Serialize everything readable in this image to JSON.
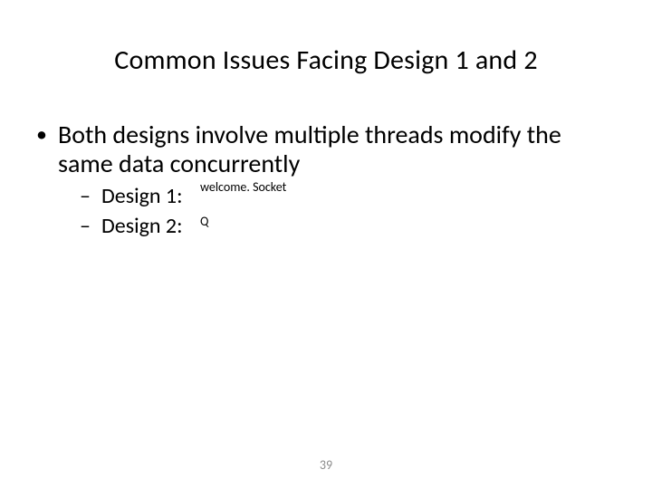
{
  "title": "Common Issues Facing Design 1 and 2",
  "bullet_main": "Both designs involve multiple threads modify the same data concurrently",
  "sub1_label": "Design 1:",
  "sub1_annot": "welcome. Socket",
  "sub2_label": "Design 2:",
  "sub2_annot": "Q",
  "page_number": "39"
}
